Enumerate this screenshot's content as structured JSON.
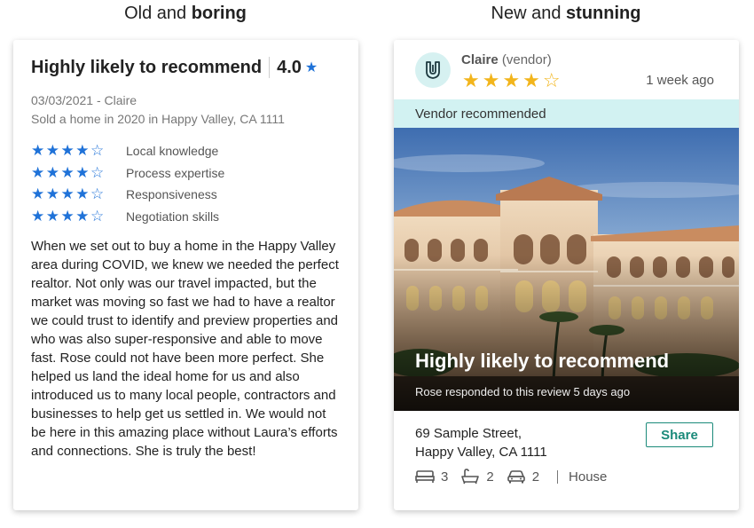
{
  "headings": {
    "left_normal": "Old and ",
    "left_bold": "boring",
    "right_normal": "New and ",
    "right_bold": "stunning"
  },
  "old_card": {
    "title": "Highly likely to recommend",
    "rating": "4.0",
    "date_author": "03/03/2021 - Claire",
    "sold_info": "Sold a home in 2020 in Happy Valley, CA 1111",
    "criteria": [
      {
        "stars": "★★★★☆",
        "label": "Local knowledge"
      },
      {
        "stars": "★★★★☆",
        "label": "Process expertise"
      },
      {
        "stars": "★★★★☆",
        "label": "Responsiveness"
      },
      {
        "stars": "★★★★☆",
        "label": "Negotiation skills"
      }
    ],
    "review": "When we set out to buy a home in the Happy Valley area during COVID, we knew we needed the perfect realtor.  Not only was our travel impacted, but the market was moving so fast we had to have a realtor we could trust to identify and preview properties and who was also super-responsive and able to move fast.  Rose could not have been more perfect.  She helped us land the ideal home for us and also introduced us to many local people, contractors and businesses to help get us settled in.  We would not be here in this amazing place without Laura’s efforts and connections.  She is truly the best!"
  },
  "new_card": {
    "vendor_name": "Claire",
    "vendor_role": "(vendor)",
    "stars_filled": "★★★★",
    "stars_empty": "☆",
    "time_ago": "1 week ago",
    "banner": "Vendor recommended",
    "photo_title": "Highly likely to recommend",
    "photo_sub": "Rose responded to this review 5 days ago",
    "address_line1": "69 Sample Street,",
    "address_line2": "Happy Valley, CA 1111",
    "share_label": "Share",
    "beds": "3",
    "baths": "2",
    "garage": "2",
    "property_type": "House"
  },
  "colors": {
    "star_blue": "#1f72d8",
    "star_gold": "#f2b51c",
    "banner_teal": "#d2f2f2",
    "share_green": "#1b8a7a"
  },
  "icons": [
    "star-icon",
    "vendor-logo-icon",
    "bed-icon",
    "bath-icon",
    "car-icon"
  ]
}
